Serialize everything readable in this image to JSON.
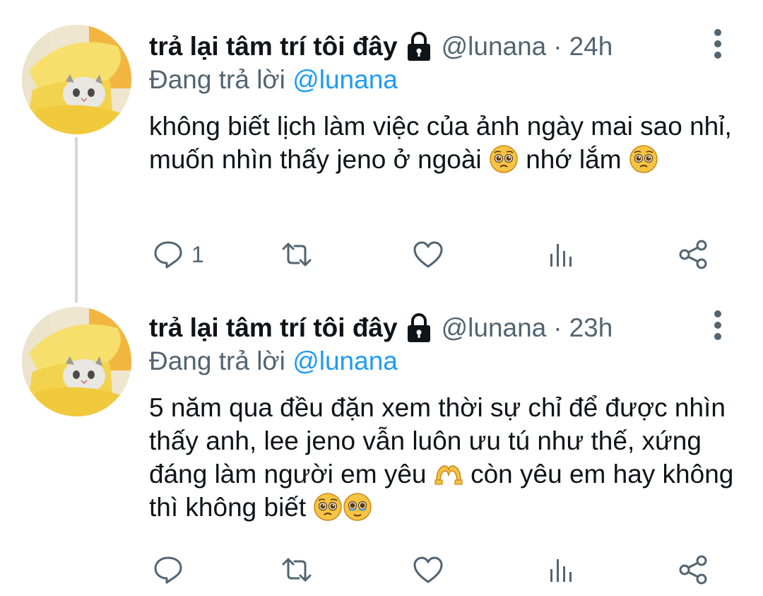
{
  "colors": {
    "text": "#0f1419",
    "secondary": "#536471",
    "mention": "#1d9bf0",
    "thread_line": "#cfd9de"
  },
  "tweets": [
    {
      "display_name": "trả lại tâm trí tôi đây",
      "handle": "@lunana",
      "separator": "·",
      "time": "24h",
      "replying_prefix": "Đang trả lời",
      "replying_mention": "@lunana",
      "text_parts": [
        "không biết lịch làm việc của ảnh ngày mai sao nhỉ, muốn nhìn thấy jeno ở ngoài ",
        " nhớ lắm "
      ],
      "emojis": [
        "pleading-face-emoji",
        "pleading-face-emoji"
      ],
      "reply_count": "1",
      "icons": [
        "reply-icon",
        "retweet-icon",
        "like-icon",
        "views-icon",
        "share-icon"
      ]
    },
    {
      "display_name": "trả lại tâm trí tôi đây",
      "handle": "@lunana",
      "separator": "·",
      "time": "23h",
      "replying_prefix": "Đang trả lời",
      "replying_mention": "@lunana",
      "text_parts": [
        "5 năm qua đều đặn xem thời sự chỉ để được nhìn thấy anh, lee jeno vẫn luôn ưu tú như thế, xứng đáng làm người em yêu ",
        " còn yêu em hay không thì không biết "
      ],
      "emojis": [
        "heart-hands-emoji",
        "pleading-face-emoji",
        "holding-back-tears-emoji"
      ],
      "reply_count": "",
      "icons": [
        "reply-icon",
        "retweet-icon",
        "like-icon",
        "views-icon",
        "share-icon"
      ]
    }
  ]
}
